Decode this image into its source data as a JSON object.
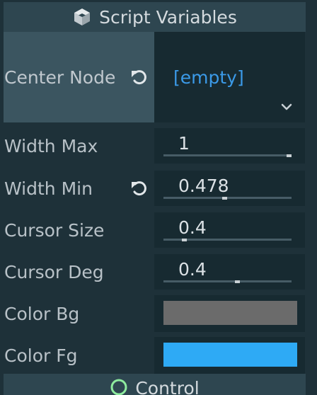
{
  "section": {
    "title": "Script Variables",
    "icon": "script-cube-icon"
  },
  "properties": {
    "center_node": {
      "label": "Center Node",
      "value": "[empty]",
      "has_revert": true
    },
    "width_max": {
      "label": "Width Max",
      "value": "1",
      "slider_fraction": 1.0
    },
    "width_min": {
      "label": "Width Min",
      "value": "0.478",
      "slider_fraction": 0.478,
      "has_revert": true
    },
    "cursor_size": {
      "label": "Cursor Size",
      "value": "0.4",
      "slider_fraction": 0.15
    },
    "cursor_deg": {
      "label": "Cursor Deg",
      "value": "0.4",
      "slider_fraction": 0.58
    },
    "color_bg": {
      "label": "Color Bg",
      "color": "#6b6b6b"
    },
    "color_fg": {
      "label": "Color Fg",
      "color": "#2eaaf5"
    }
  },
  "next_section": {
    "title": "Control",
    "icon": "control-circle-icon"
  },
  "colors": {
    "accent": "#3b9ae8",
    "panel_bg": "#1e3139",
    "header_bg": "#2e4650"
  }
}
